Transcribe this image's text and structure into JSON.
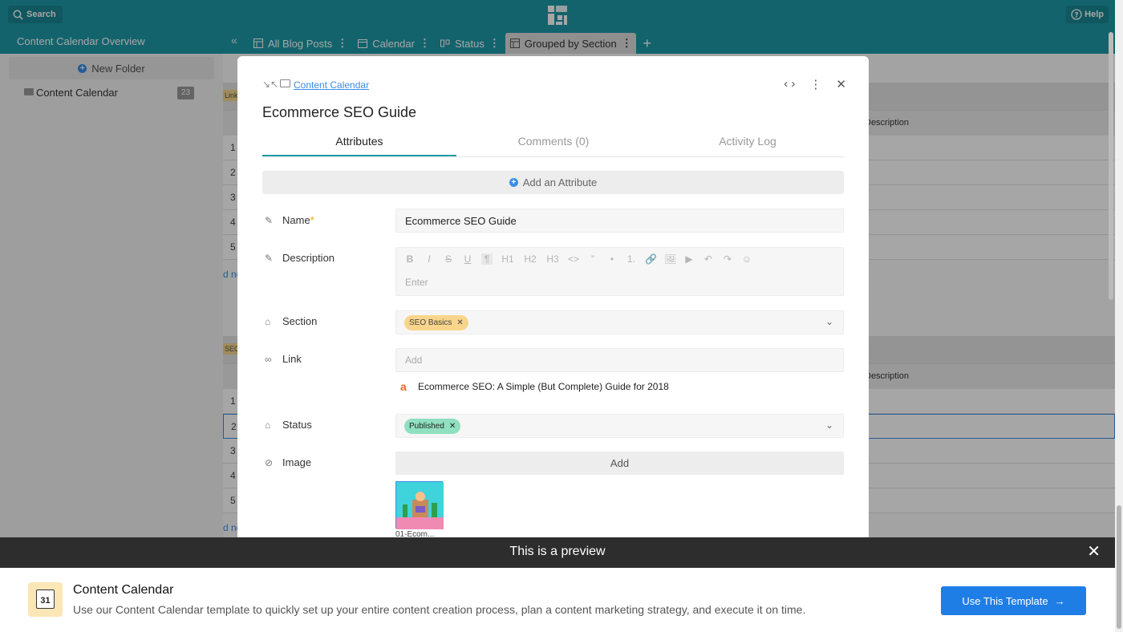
{
  "topbar": {
    "search_label": "Search",
    "help_label": "Help"
  },
  "subbar": {
    "title": "Content Calendar Overview"
  },
  "tabs": [
    {
      "label": "All Blog Posts",
      "icon": "table-icon"
    },
    {
      "label": "Calendar",
      "icon": "calendar-icon"
    },
    {
      "label": "Status",
      "icon": "kanban-icon"
    },
    {
      "label": "Grouped by Section",
      "icon": "table-icon"
    }
  ],
  "sidebar": {
    "new_folder": "New Folder",
    "folder_label": "Content Calendar",
    "folder_count": "23"
  },
  "grid": {
    "group1_tag": "Link",
    "group2_tag": "SEO",
    "col_description": "Description",
    "rows_group1": [
      "1",
      "2",
      "3",
      "4",
      "5"
    ],
    "rows_group2": [
      "1",
      "2",
      "3",
      "4",
      "5"
    ],
    "add_new": "d ne"
  },
  "modal": {
    "breadcrumb": "Content Calendar",
    "title": "Ecommerce SEO Guide",
    "tabs": [
      "Attributes",
      "Comments (0)",
      "Activity Log"
    ],
    "add_attribute": "Add an Attribute",
    "name_label": "Name",
    "name_value": "Ecommerce SEO Guide",
    "description_label": "Description",
    "description_placeholder": "Enter",
    "toolbar": [
      "B",
      "I",
      "S",
      "U",
      "¶",
      "H1",
      "H2",
      "H3",
      "<>",
      "”",
      "•",
      "1.",
      "🔗",
      "🖼",
      "▶",
      "↶",
      "↷",
      "☺"
    ],
    "section_label": "Section",
    "section_value": "SEO Basics",
    "link_label": "Link",
    "link_placeholder": "Add",
    "link_preview": "Ecommerce SEO: A Simple (But Complete) Guide for 2018",
    "status_label": "Status",
    "status_value": "Published",
    "image_label": "Image",
    "image_add": "Add",
    "image_caption": "01-Ecom..."
  },
  "preview": {
    "text": "This is a preview",
    "title": "Content Calendar",
    "description": "Use our Content Calendar template to quickly set up your entire content creation process, plan a content marketing strategy, and execute it on time.",
    "cta": "Use This Template",
    "calendar_day": "31"
  },
  "colors": {
    "teal": "#1e99a6",
    "accent_blue": "#1f7ee6",
    "section_pill": "#f9d58c",
    "status_pill": "#8fe0c0"
  }
}
